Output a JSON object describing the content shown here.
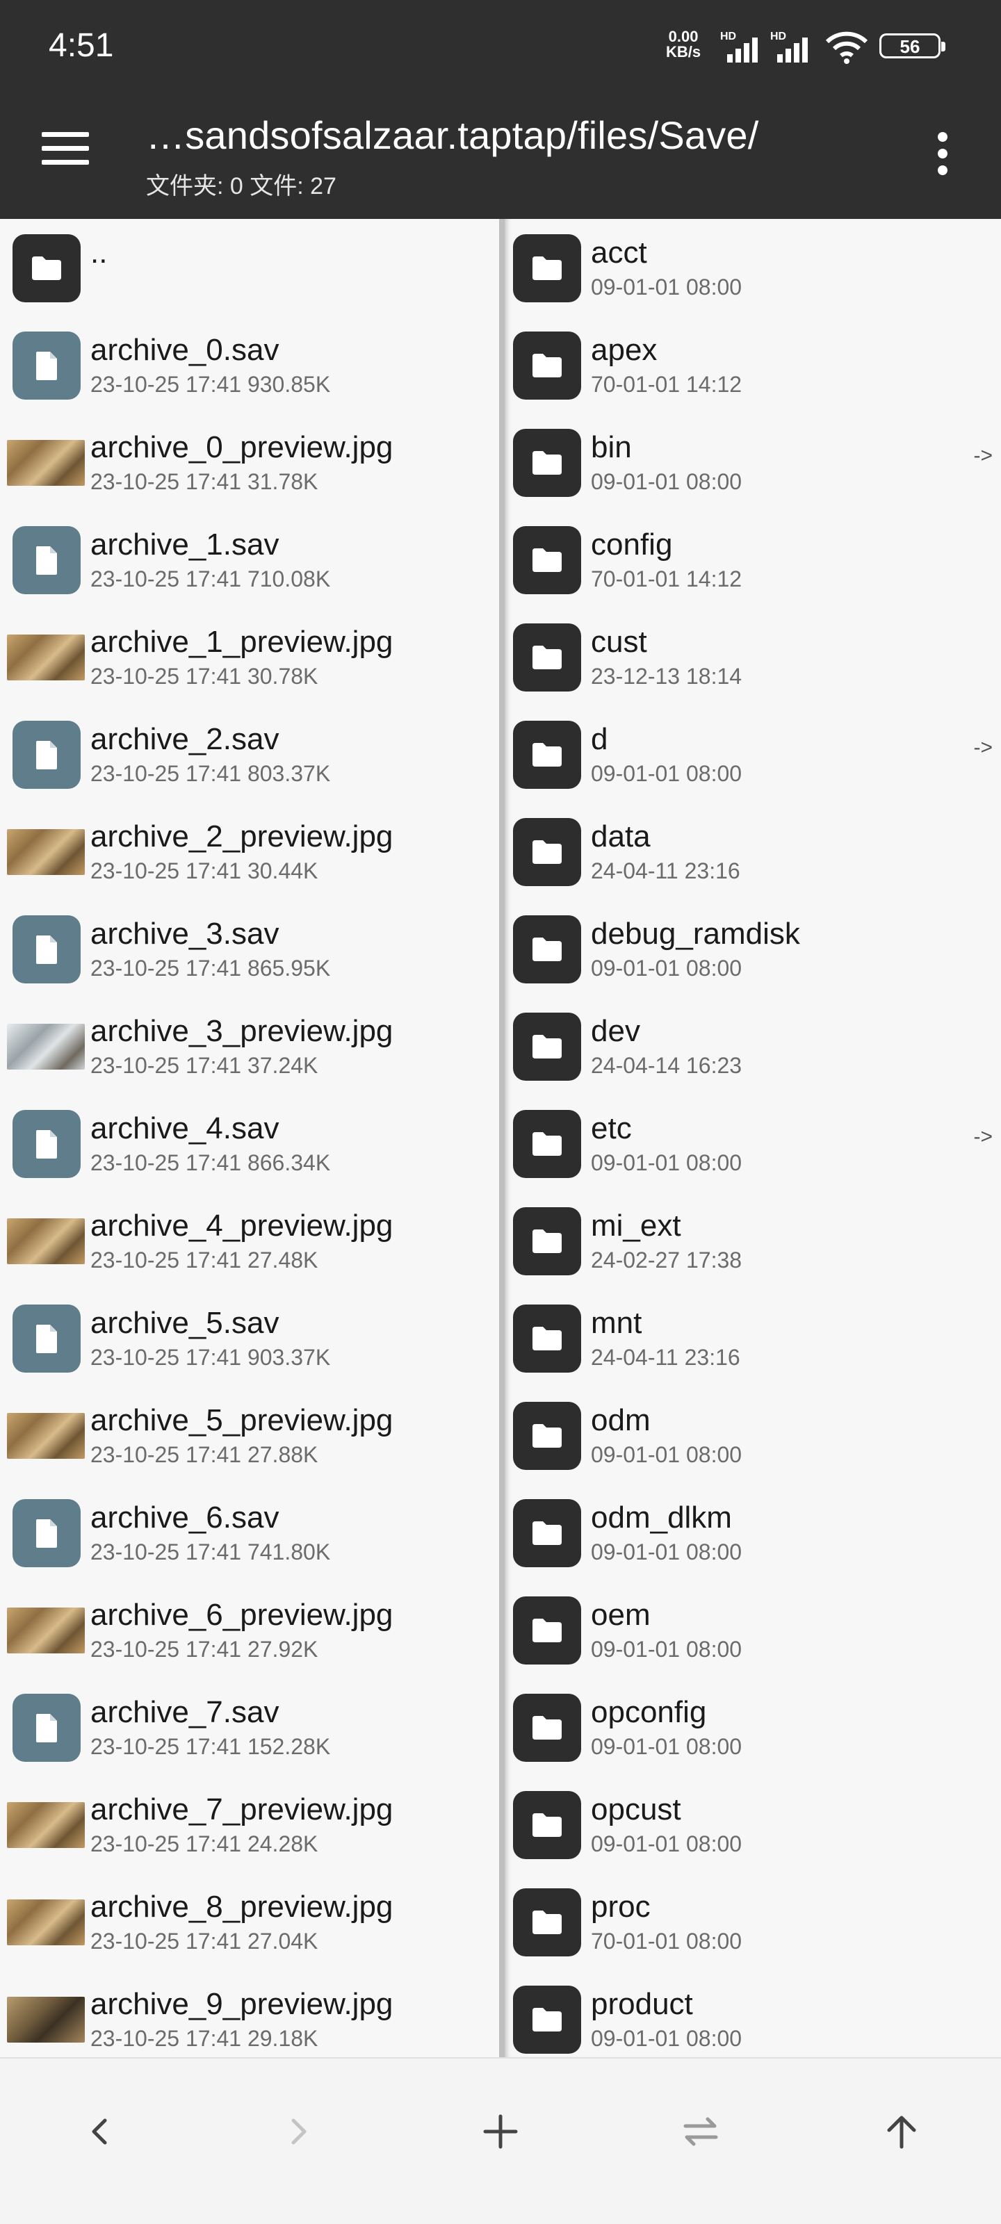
{
  "status": {
    "time": "4:51",
    "net_speed_value": "0.00",
    "net_speed_unit": "KB/s",
    "hd_label": "HD",
    "battery": "56"
  },
  "appbar": {
    "title": "…sandsofsalzaar.taptap/files/Save/",
    "subtitle": "文件夹: 0  文件: 27"
  },
  "left_pane": {
    "items": [
      {
        "name": "..",
        "meta": "",
        "kind": "folder"
      },
      {
        "name": "archive_0.sav",
        "meta": "23-10-25 17:41  930.85K",
        "kind": "file"
      },
      {
        "name": "archive_0_preview.jpg",
        "meta": "23-10-25 17:41  31.78K",
        "kind": "image"
      },
      {
        "name": "archive_1.sav",
        "meta": "23-10-25 17:41  710.08K",
        "kind": "file"
      },
      {
        "name": "archive_1_preview.jpg",
        "meta": "23-10-25 17:41  30.78K",
        "kind": "image"
      },
      {
        "name": "archive_2.sav",
        "meta": "23-10-25 17:41  803.37K",
        "kind": "file"
      },
      {
        "name": "archive_2_preview.jpg",
        "meta": "23-10-25 17:41  30.44K",
        "kind": "image"
      },
      {
        "name": "archive_3.sav",
        "meta": "23-10-25 17:41  865.95K",
        "kind": "file"
      },
      {
        "name": "archive_3_preview.jpg",
        "meta": "23-10-25 17:41  37.24K",
        "kind": "image-snow"
      },
      {
        "name": "archive_4.sav",
        "meta": "23-10-25 17:41  866.34K",
        "kind": "file"
      },
      {
        "name": "archive_4_preview.jpg",
        "meta": "23-10-25 17:41  27.48K",
        "kind": "image"
      },
      {
        "name": "archive_5.sav",
        "meta": "23-10-25 17:41  903.37K",
        "kind": "file"
      },
      {
        "name": "archive_5_preview.jpg",
        "meta": "23-10-25 17:41  27.88K",
        "kind": "image"
      },
      {
        "name": "archive_6.sav",
        "meta": "23-10-25 17:41  741.80K",
        "kind": "file"
      },
      {
        "name": "archive_6_preview.jpg",
        "meta": "23-10-25 17:41  27.92K",
        "kind": "image"
      },
      {
        "name": "archive_7.sav",
        "meta": "23-10-25 17:41  152.28K",
        "kind": "file"
      },
      {
        "name": "archive_7_preview.jpg",
        "meta": "23-10-25 17:41  24.28K",
        "kind": "image"
      },
      {
        "name": "archive_8_preview.jpg",
        "meta": "23-10-25 17:41  27.04K",
        "kind": "image"
      },
      {
        "name": "archive_9_preview.jpg",
        "meta": "23-10-25 17:41  29.18K",
        "kind": "image-dark"
      }
    ]
  },
  "right_pane": {
    "items": [
      {
        "name": "acct",
        "meta": "09-01-01 08:00",
        "link": ""
      },
      {
        "name": "apex",
        "meta": "70-01-01 14:12",
        "link": ""
      },
      {
        "name": "bin",
        "meta": "09-01-01 08:00",
        "link": "->"
      },
      {
        "name": "config",
        "meta": "70-01-01 14:12",
        "link": ""
      },
      {
        "name": "cust",
        "meta": "23-12-13 18:14",
        "link": ""
      },
      {
        "name": "d",
        "meta": "09-01-01 08:00",
        "link": "->"
      },
      {
        "name": "data",
        "meta": "24-04-11 23:16",
        "link": ""
      },
      {
        "name": "debug_ramdisk",
        "meta": "09-01-01 08:00",
        "link": ""
      },
      {
        "name": "dev",
        "meta": "24-04-14 16:23",
        "link": ""
      },
      {
        "name": "etc",
        "meta": "09-01-01 08:00",
        "link": "->"
      },
      {
        "name": "mi_ext",
        "meta": "24-02-27 17:38",
        "link": ""
      },
      {
        "name": "mnt",
        "meta": "24-04-11 23:16",
        "link": ""
      },
      {
        "name": "odm",
        "meta": "09-01-01 08:00",
        "link": ""
      },
      {
        "name": "odm_dlkm",
        "meta": "09-01-01 08:00",
        "link": ""
      },
      {
        "name": "oem",
        "meta": "09-01-01 08:00",
        "link": ""
      },
      {
        "name": "opconfig",
        "meta": "09-01-01 08:00",
        "link": ""
      },
      {
        "name": "opcust",
        "meta": "09-01-01 08:00",
        "link": ""
      },
      {
        "name": "proc",
        "meta": "70-01-01 08:00",
        "link": ""
      },
      {
        "name": "product",
        "meta": "09-01-01 08:00",
        "link": ""
      }
    ]
  },
  "bottom_bar": {
    "buttons": [
      "back-icon",
      "forward-icon",
      "add-icon",
      "swap-panes-icon",
      "up-icon"
    ]
  },
  "colors": {
    "bar_bg": "#2f2f2f",
    "folder_icon": "#2d2d2d",
    "file_icon": "#607d8b"
  }
}
